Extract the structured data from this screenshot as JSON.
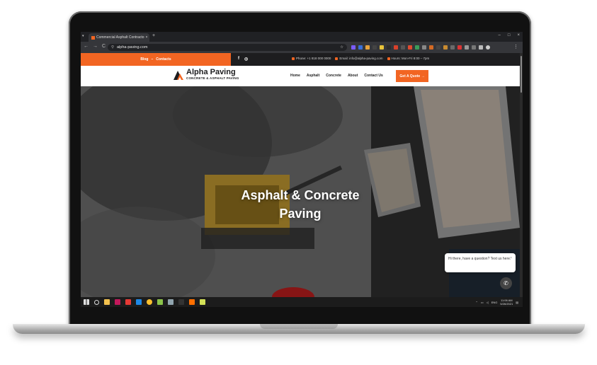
{
  "browser": {
    "tab_title": "Commercial Asphalt Contracto",
    "tab_close": "×",
    "new_tab": "+",
    "window_controls": [
      "–",
      "□",
      "×"
    ],
    "nav_buttons": [
      "←",
      "→",
      "C"
    ],
    "url": "alpha-paving.com",
    "star": "☆"
  },
  "site": {
    "topbar": {
      "links": [
        "Blog",
        "–",
        "Contacts"
      ],
      "social": [
        "f",
        "◎"
      ],
      "phone": "Phone: +1 818 000 0000",
      "email": "Email: info@alpha-paving.com",
      "hours": "Hours: Mon-Fri 8:00 – 7pm"
    },
    "logo": {
      "name": "Alpha Paving",
      "tagline": "CONCRETE & ASPHALT PAVING"
    },
    "nav": [
      "Home",
      "Asphalt",
      "Concrete",
      "About",
      "Contact Us"
    ],
    "cta": "Get A Quote →",
    "hero": {
      "title_line1": "Asphalt & Concrete",
      "title_line2": "Paving"
    },
    "chat": {
      "message": "Hi there, have a question? Text us here.",
      "close": "×",
      "button_icon": "chat-icon"
    }
  },
  "taskbar": {
    "language": "ENG",
    "time": "11:06 AM",
    "date": "5/26/2021"
  },
  "colors": {
    "accent": "#f26522",
    "dark": "#1d1d1f"
  }
}
